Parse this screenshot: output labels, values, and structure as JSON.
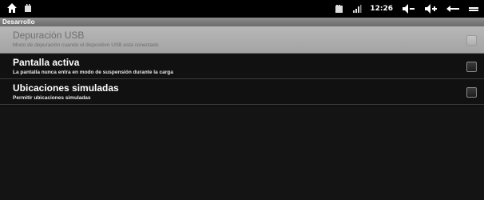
{
  "status_bar": {
    "time": "12:26",
    "left_icons": [
      "home-icon",
      "notification-icon"
    ],
    "right_icons": [
      "sd-card-icon",
      "signal-icon",
      "volume-down-icon",
      "volume-up-icon",
      "back-icon",
      "menu-icon"
    ]
  },
  "header": {
    "title": "Desarrollo"
  },
  "settings": [
    {
      "title": "Depuración USB",
      "summary": "Modo de depuración cuando el dispositivo USB está conectado",
      "enabled": false,
      "checked": false
    },
    {
      "title": "Pantalla activa",
      "summary": "La pantalla nunca entra en modo de suspensión durante la carga",
      "enabled": true,
      "checked": false
    },
    {
      "title": "Ubicaciones simuladas",
      "summary": "Permitir ubicaciones simuladas",
      "enabled": true,
      "checked": false
    }
  ],
  "colors": {
    "background": "#111111",
    "title_strip": "#7a7a7a",
    "disabled_row": "#aaaaaa",
    "text_primary": "#ffffff"
  }
}
